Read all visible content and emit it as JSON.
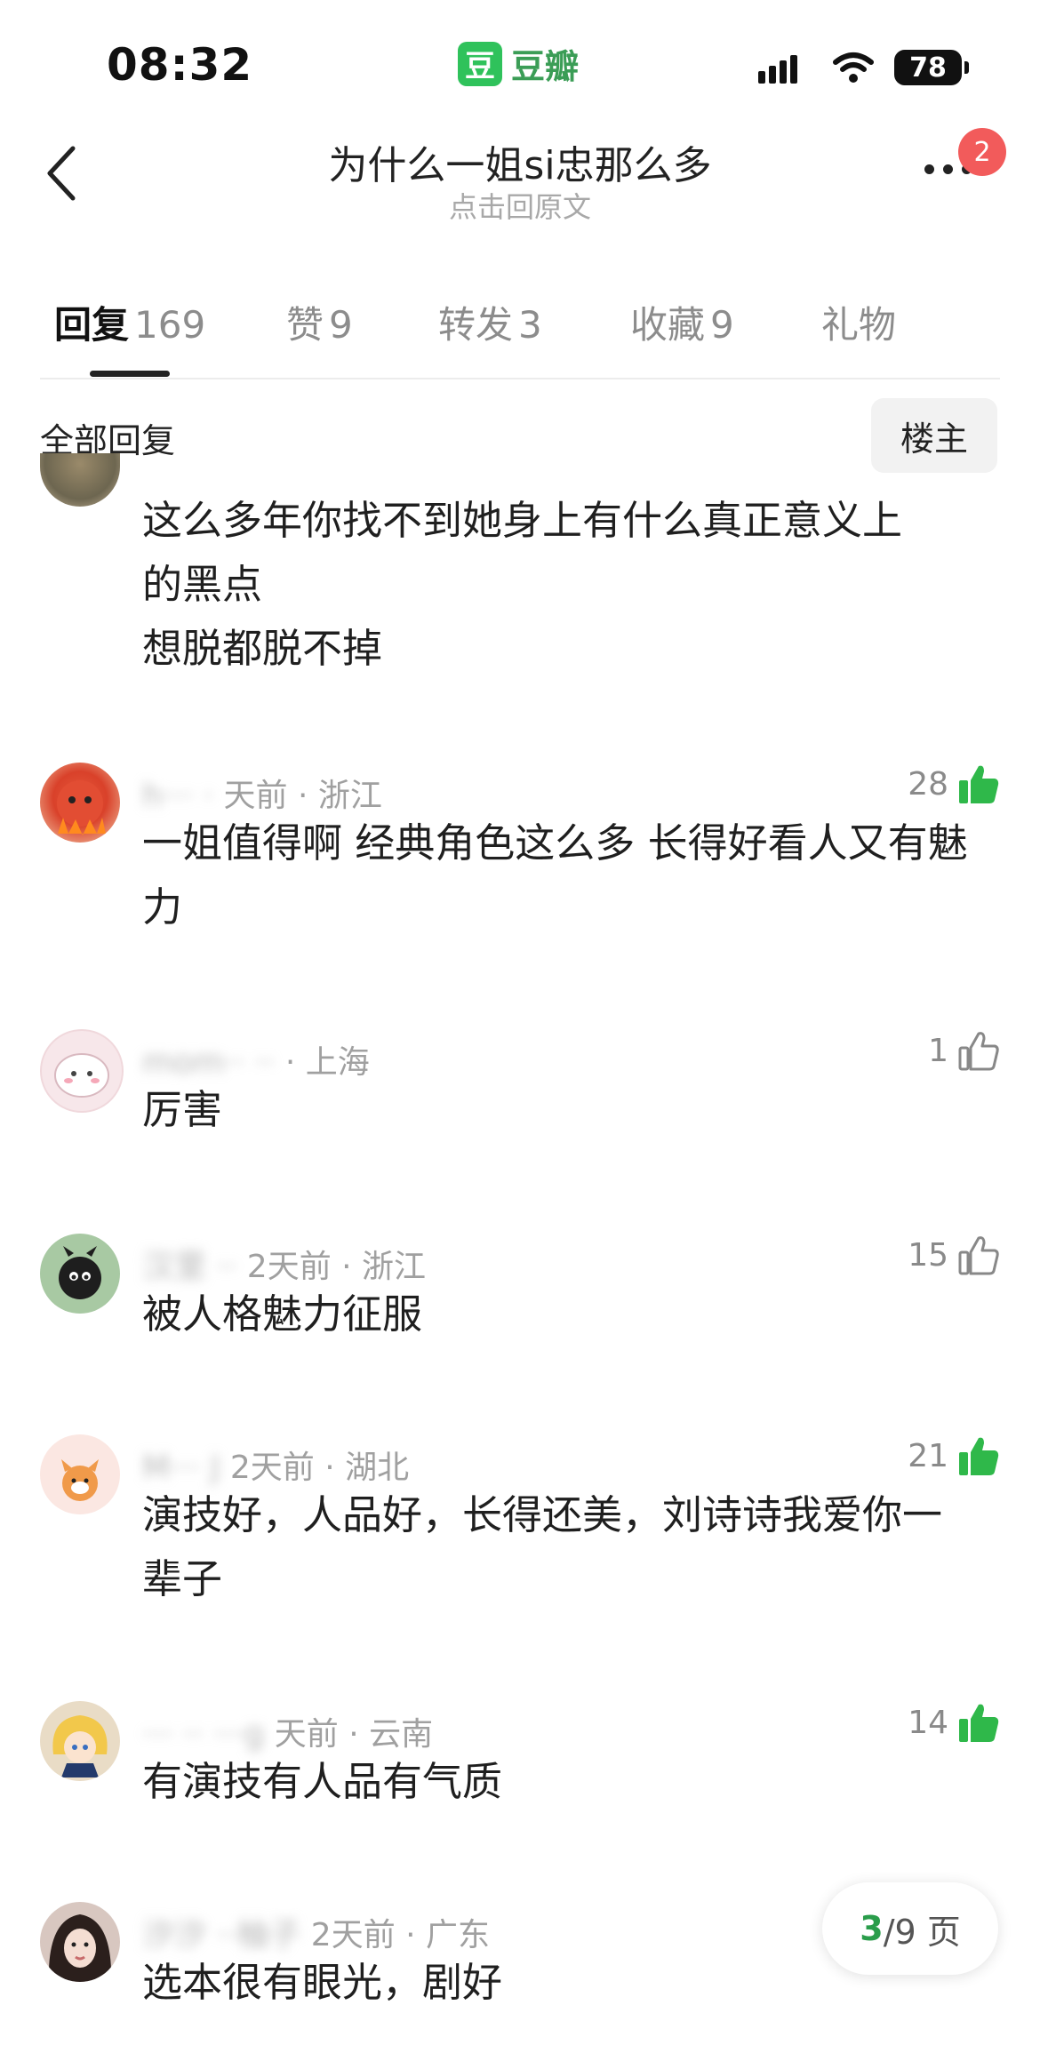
{
  "status_bar": {
    "time": "08:32",
    "app_name": "豆瓣",
    "app_logo_char": "豆",
    "battery": "78"
  },
  "header": {
    "title": "为什么一姐si忠那么多",
    "subtitle": "点击回原文",
    "notification_count": "2"
  },
  "tabs": [
    {
      "label": "回复",
      "count": "169",
      "active": true
    },
    {
      "label": "赞",
      "count": "9",
      "active": false
    },
    {
      "label": "转发",
      "count": "3",
      "active": false
    },
    {
      "label": "收藏",
      "count": "9",
      "active": false
    },
    {
      "label": "礼物",
      "count": "",
      "active": false
    }
  ],
  "filter": {
    "label": "全部回复",
    "owner_button": "楼主"
  },
  "comments": [
    {
      "nickname": "",
      "time": "",
      "location": "",
      "likes": "",
      "liked": false,
      "text": "这么多年你找不到她身上有什么真正意义上的黑点\n想脱都脱不掉"
    },
    {
      "nickname": "h··· ·",
      "time": "天前",
      "location": "浙江",
      "likes": "28",
      "liked": true,
      "text": "一姐值得啊  经典角色这么多 长得好看人又有魅力"
    },
    {
      "nickname": "mom·· ··",
      "time": "",
      "location": "上海",
      "likes": "1",
      "liked": false,
      "text": "厉害"
    },
    {
      "nickname": "汉里 ··",
      "time": "2天前",
      "location": "浙江",
      "likes": "15",
      "liked": false,
      "text": "被人格魅力征服"
    },
    {
      "nickname": "M··· J",
      "time": "2天前",
      "location": "湖北",
      "likes": "21",
      "liked": true,
      "text": "演技好，人品好，长得还美，刘诗诗我爱你一辈子"
    },
    {
      "nickname": "··· ·· ···g",
      "time": "天前",
      "location": "云南",
      "likes": "14",
      "liked": true,
      "text": "有演技有人品有气质"
    },
    {
      "nickname": "汐汐 ··柚子",
      "time": "2天前",
      "location": "广东",
      "likes": "",
      "liked": false,
      "text": "选本很有眼光，剧好"
    }
  ],
  "pager": {
    "current": "3",
    "total_text": "/9 页"
  },
  "colors": {
    "accent_green": "#2a9d4b",
    "badge_red": "#f25b5b",
    "like_green": "#2fb84a"
  }
}
